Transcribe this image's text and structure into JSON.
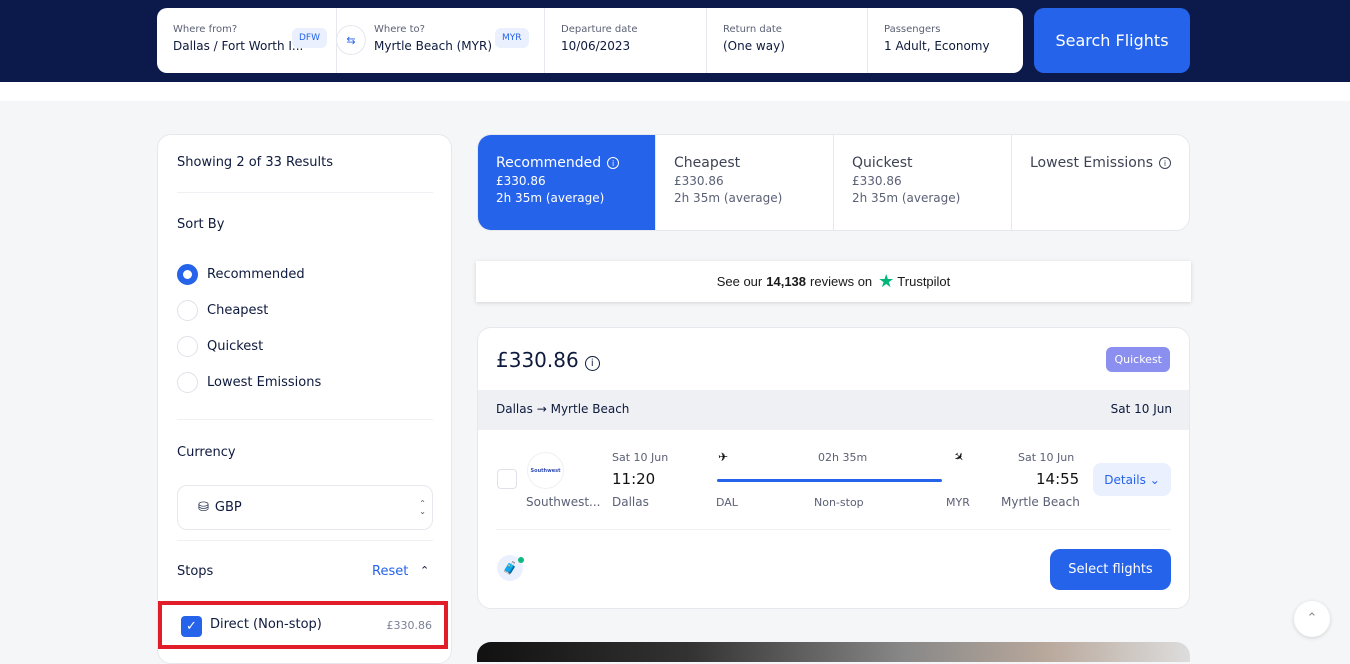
{
  "search": {
    "from_label": "Where from?",
    "from_value": "Dallas / Fort Worth I...",
    "from_code": "DFW",
    "to_label": "Where to?",
    "to_value": "Myrtle Beach (MYR)",
    "to_code": "MYR",
    "departure_label": "Departure date",
    "departure_value": "10/06/2023",
    "return_label": "Return date",
    "return_value": "(One way)",
    "passengers_label": "Passengers",
    "passengers_value": "1 Adult, Economy",
    "search_button": "Search Flights",
    "swap_icon": "swap-arrows"
  },
  "sidebar": {
    "showing": "Showing 2 of 33 Results",
    "sort_by_title": "Sort By",
    "sort_options": [
      {
        "label": "Recommended",
        "selected": true
      },
      {
        "label": "Cheapest",
        "selected": false
      },
      {
        "label": "Quickest",
        "selected": false
      },
      {
        "label": "Lowest Emissions",
        "selected": false
      }
    ],
    "currency_title": "Currency",
    "currency_value": "GBP",
    "stops_title": "Stops",
    "reset_label": "Reset",
    "stops_options": [
      {
        "label": "Direct (Non-stop)",
        "price": "£330.86",
        "checked": true
      }
    ]
  },
  "sort_tabs": [
    {
      "name": "Recommended",
      "price": "£330.86",
      "duration": "2h 35m (average)",
      "active": true,
      "info": true
    },
    {
      "name": "Cheapest",
      "price": "£330.86",
      "duration": "2h 35m (average)",
      "active": false,
      "info": false
    },
    {
      "name": "Quickest",
      "price": "£330.86",
      "duration": "2h 35m (average)",
      "active": false,
      "info": false
    },
    {
      "name": "Lowest Emissions",
      "price": "",
      "duration": "",
      "active": false,
      "info": true
    }
  ],
  "trustpilot": {
    "prefix": "See our",
    "count": "14,138",
    "suffix": "reviews on",
    "brand": "Trustpilot",
    "star_color": "#00b67a"
  },
  "result": {
    "price": "£330.86",
    "badge": "Quickest",
    "route_from": "Dallas",
    "route_to": "Myrtle Beach",
    "route_date": "Sat 10 Jun",
    "airline_logo_text": "Southwest",
    "airline": "Southwest...",
    "dep_date": "Sat 10 Jun",
    "dep_time": "11:20",
    "dep_city": "Dallas",
    "dep_code": "DAL",
    "duration": "02h 35m",
    "stops": "Non-stop",
    "arr_code": "MYR",
    "arr_date": "Sat 10 Jun",
    "arr_time": "14:55",
    "arr_city": "Myrtle Beach",
    "details_label": "Details",
    "select_label": "Select flights"
  },
  "colors": {
    "brand_blue": "#2563eb",
    "header_navy": "#0b1a4a",
    "badge_purple": "#8b8ff0",
    "highlight_red": "#e11d2a"
  }
}
